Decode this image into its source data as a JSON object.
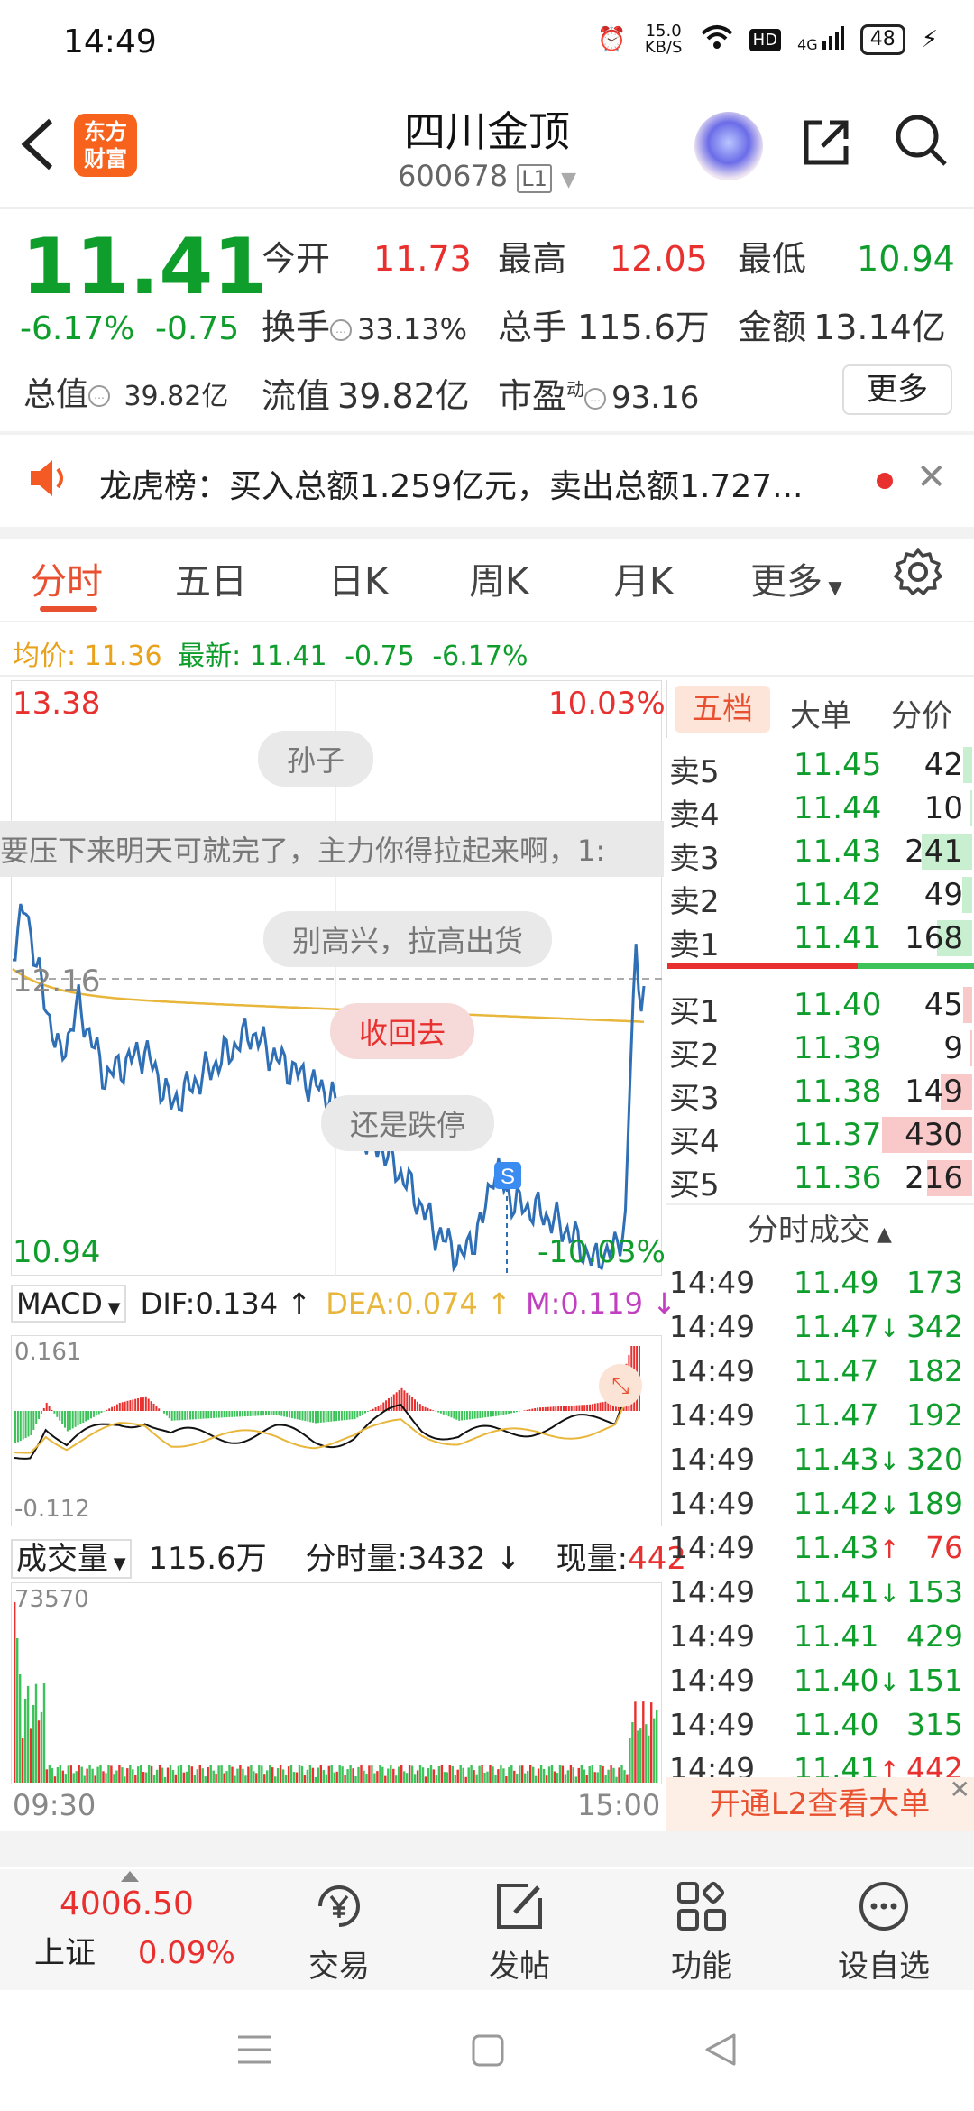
{
  "status": {
    "time": "14:49",
    "net_speed": "15.0 KB/S",
    "hd": "HD",
    "signal": "4G",
    "battery": "48"
  },
  "header": {
    "logo_line1": "东方",
    "logo_line2": "财富",
    "title": "四川金顶",
    "code": "600678",
    "level": "L1"
  },
  "quote": {
    "price": "11.41",
    "change_pct": "-6.17%",
    "change": "-0.75",
    "open_label": "今开",
    "open": "11.73",
    "high_label": "最高",
    "high": "12.05",
    "low_label": "最低",
    "low": "10.94",
    "turnover_label": "换手",
    "turnover": "33.13%",
    "volume_label": "总手",
    "volume": "115.6万",
    "amount_label": "金额",
    "amount": "13.14亿",
    "mcap_label": "总值",
    "mcap": "39.82亿",
    "float_label": "流值",
    "float": "39.82亿",
    "pe_label": "市盈",
    "pe_sup": "动",
    "pe": "93.16",
    "more": "更多"
  },
  "banner": {
    "text": "龙虎榜：买入总额1.259亿元，卖出总额1.727..."
  },
  "tabs": [
    "分时",
    "五日",
    "日K",
    "周K",
    "月K",
    "更多"
  ],
  "avgline": {
    "avg_label": "均价:",
    "avg": "11.36",
    "latest_label": "最新:",
    "latest": "11.41",
    "chg": "-0.75",
    "pct": "-6.17%"
  },
  "chart": {
    "top_price": "13.38",
    "top_pct": "10.03%",
    "ref_price": "12.16",
    "bottom_price": "10.94",
    "bottom_pct": "-10.03%",
    "s_marker": "S",
    "start_time": "09:30",
    "end_time": "15:00"
  },
  "danmu": [
    "孙子",
    "要压下来明天可就完了，主力你得拉起来啊，1:",
    "别高兴，拉高出货",
    "收回去",
    "还是跌停"
  ],
  "macd": {
    "label": "MACD",
    "dif": "DIF:0.134",
    "dea": "DEA:0.074",
    "m": "M:0.119",
    "max": "0.161",
    "min": "-0.112"
  },
  "volume": {
    "label": "成交量",
    "total": "115.6万",
    "minute": "分时量:3432",
    "now_label": "现量:",
    "now": "442",
    "max": "73570"
  },
  "book_tabs": [
    "五档",
    "大单",
    "分价"
  ],
  "asks": [
    {
      "label": "卖5",
      "price": "11.45",
      "vol": "42",
      "fill": 0.1
    },
    {
      "label": "卖4",
      "price": "11.44",
      "vol": "10",
      "fill": 0.02
    },
    {
      "label": "卖3",
      "price": "11.43",
      "vol": "241",
      "fill": 0.56
    },
    {
      "label": "卖2",
      "price": "11.42",
      "vol": "49",
      "fill": 0.11
    },
    {
      "label": "卖1",
      "price": "11.41",
      "vol": "168",
      "fill": 0.39
    }
  ],
  "bids": [
    {
      "label": "买1",
      "price": "11.40",
      "vol": "45",
      "fill": 0.1
    },
    {
      "label": "买2",
      "price": "11.39",
      "vol": "9",
      "fill": 0.02
    },
    {
      "label": "买3",
      "price": "11.38",
      "vol": "149",
      "fill": 0.35
    },
    {
      "label": "买4",
      "price": "11.37",
      "vol": "430",
      "fill": 1.0
    },
    {
      "label": "买5",
      "price": "11.36",
      "vol": "216",
      "fill": 0.5
    }
  ],
  "trades_title": "分时成交",
  "trades": [
    {
      "t": "14:49",
      "p": "11.49",
      "dir": "",
      "v": "173",
      "side": "g"
    },
    {
      "t": "14:49",
      "p": "11.47",
      "dir": "↓",
      "v": "342",
      "side": "g"
    },
    {
      "t": "14:49",
      "p": "11.47",
      "dir": "",
      "v": "182",
      "side": "g"
    },
    {
      "t": "14:49",
      "p": "11.47",
      "dir": "",
      "v": "192",
      "side": "g"
    },
    {
      "t": "14:49",
      "p": "11.43",
      "dir": "↓",
      "v": "320",
      "side": "g"
    },
    {
      "t": "14:49",
      "p": "11.42",
      "dir": "↓",
      "v": "189",
      "side": "g"
    },
    {
      "t": "14:49",
      "p": "11.43",
      "dir": "↑",
      "v": "76",
      "side": "r"
    },
    {
      "t": "14:49",
      "p": "11.41",
      "dir": "↓",
      "v": "153",
      "side": "g"
    },
    {
      "t": "14:49",
      "p": "11.41",
      "dir": "",
      "v": "429",
      "side": "g"
    },
    {
      "t": "14:49",
      "p": "11.40",
      "dir": "↓",
      "v": "151",
      "side": "g"
    },
    {
      "t": "14:49",
      "p": "11.40",
      "dir": "",
      "v": "315",
      "side": "g"
    },
    {
      "t": "14:49",
      "p": "11.41",
      "dir": "↑",
      "v": "442",
      "side": "r"
    }
  ],
  "l2_promo": "开通L2查看大单",
  "bottomnav": {
    "index_value": "4006.50",
    "index_name": "上证",
    "index_pct": "0.09%",
    "items": [
      "交易",
      "发帖",
      "功能",
      "设自选"
    ]
  }
}
